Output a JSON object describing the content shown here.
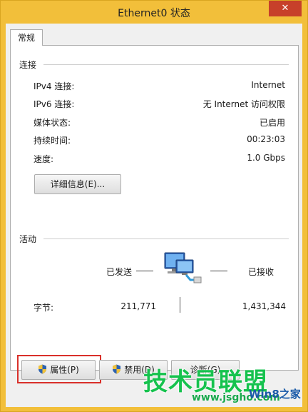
{
  "window": {
    "title": "Ethernet0 状态",
    "close_glyph": "✕"
  },
  "tabs": [
    {
      "label": "常规",
      "active": true
    }
  ],
  "connection": {
    "group_label": "连接",
    "rows": [
      {
        "label": "IPv4 连接:",
        "value": "Internet"
      },
      {
        "label": "IPv6 连接:",
        "value": "无 Internet 访问权限"
      },
      {
        "label": "媒体状态:",
        "value": "已启用"
      },
      {
        "label": "持续时间:",
        "value": "00:23:03"
      },
      {
        "label": "速度:",
        "value": "1.0 Gbps"
      }
    ],
    "details_button": "详细信息(E)..."
  },
  "activity": {
    "group_label": "活动",
    "sent_label": "已发送",
    "received_label": "已接收",
    "bytes_label": "字节:",
    "bytes_sent": "211,771",
    "bytes_received": "1,431,344"
  },
  "buttons": {
    "properties": "属性(P)",
    "disable": "禁用(D)",
    "diagnose": "诊断(G)"
  },
  "watermark": {
    "brand": "技术员联盟",
    "url": "www.jsgho.com",
    "logo_text": "Win8之家"
  },
  "colors": {
    "frame": "#f2bf3a",
    "close": "#c7402a",
    "highlight": "#d9302a",
    "watermark": "#16c24e"
  }
}
